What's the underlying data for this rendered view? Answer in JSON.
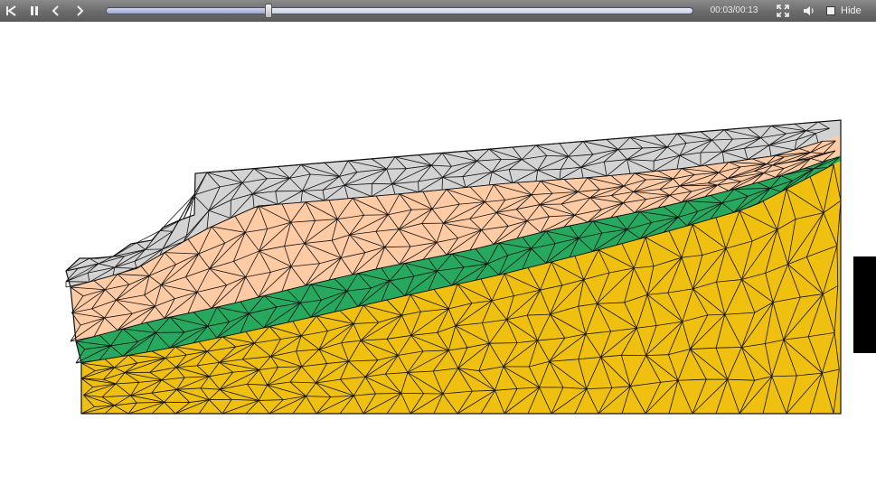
{
  "player": {
    "time_label": "00:03/00:13",
    "hide_label": "Hide",
    "hide_checked": false,
    "progress": 0.276
  },
  "icons": {
    "rewind": "skip-to-start-icon",
    "pause": "pause-icon",
    "prev": "chevron-left-icon",
    "next": "chevron-right-icon",
    "fullscreen": "fullscreen-icon",
    "volume": "speaker-icon"
  },
  "colors": {
    "toolbar": "#6c6c6c",
    "layer_top": "#d3d3d3",
    "layer_peach": "#ffcba4",
    "layer_green": "#27a85f",
    "layer_bedrock": "#f0c010",
    "mesh_line": "#111111"
  }
}
